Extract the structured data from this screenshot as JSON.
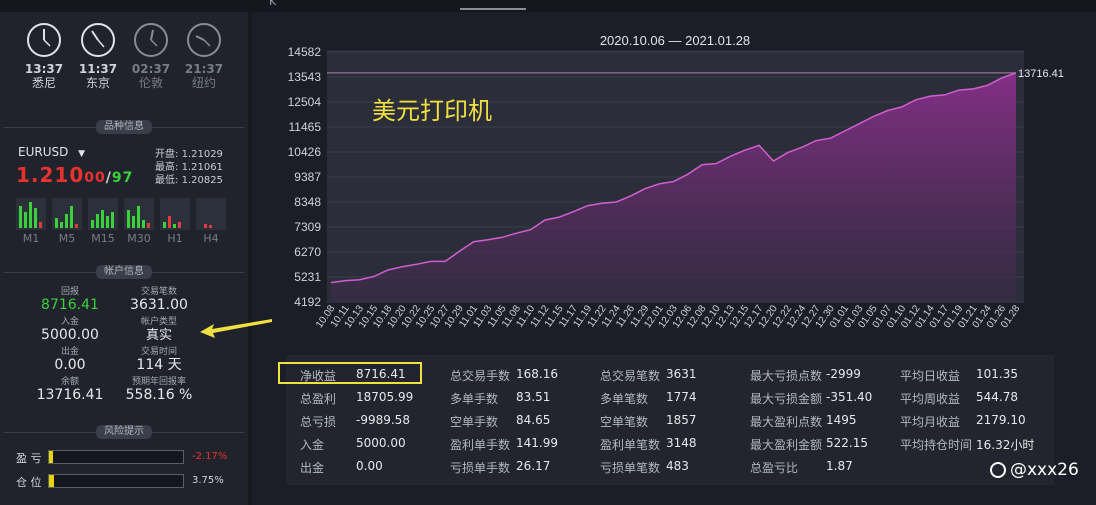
{
  "topbar": {
    "tab_fragment": "K"
  },
  "clocks": [
    {
      "time": "13:37",
      "city": "悉尼",
      "active": true
    },
    {
      "time": "11:37",
      "city": "东京",
      "active": true
    },
    {
      "time": "02:37",
      "city": "伦敦",
      "active": false
    },
    {
      "time": "21:37",
      "city": "纽约",
      "active": false
    }
  ],
  "instrument": {
    "section_title": "品种信息",
    "symbol": "EURUSD",
    "price_main": "1.210",
    "price_tail": "00",
    "price_sep": "/",
    "price_ask": "97",
    "open_label": "开盘:",
    "open": "1.21029",
    "high_label": "最高:",
    "high": "1.21061",
    "low_label": "最低:",
    "low": "1.20825",
    "timeframes": [
      "M1",
      "M5",
      "M15",
      "M30",
      "H1",
      "H4"
    ]
  },
  "account": {
    "section_title": "帐户信息",
    "return_label": "回报",
    "return_value": "8716.41",
    "trade_lots_label": "交易笔数",
    "trade_lots_value": "3631.00",
    "deposit_label": "入金",
    "deposit_value": "5000.00",
    "type_label": "帐户类型",
    "type_value": "真实",
    "withdraw_label": "出金",
    "withdraw_value": "0.00",
    "time_label": "交易时间",
    "time_value": "114 天",
    "balance_label": "余额",
    "balance_value": "13716.41",
    "annual_label": "预期年回报率",
    "annual_value": "558.16 %"
  },
  "risk": {
    "section_title": "风险提示",
    "pl_label": "盈 亏",
    "pl_value": "-2.17%",
    "pl_fill": 0.03,
    "pos_label": "仓 位",
    "pos_value": "3.75%",
    "pos_fill": 0.0375
  },
  "chart_data": {
    "type": "area",
    "title": "2020.10.06 — 2021.01.28",
    "annotation": "美元打印机",
    "last_value_label": "13716.41",
    "ylim": [
      4192,
      14582
    ],
    "y_ticks": [
      "14582",
      "13543",
      "12504",
      "11465",
      "10426",
      "9387",
      "8348",
      "7309",
      "6270",
      "5231",
      "4192"
    ],
    "x": [
      "10.08",
      "10.11",
      "10.13",
      "10.15",
      "10.18",
      "10.20",
      "10.22",
      "10.25",
      "10.27",
      "10.29",
      "11.01",
      "11.03",
      "11.05",
      "11.08",
      "11.10",
      "11.12",
      "11.15",
      "11.17",
      "11.19",
      "11.22",
      "11.24",
      "11.26",
      "11.29",
      "12.01",
      "12.03",
      "12.06",
      "12.08",
      "12.10",
      "12.13",
      "12.15",
      "12.17",
      "12.20",
      "12.22",
      "12.24",
      "12.27",
      "12.30",
      "01.01",
      "01.03",
      "01.05",
      "01.07",
      "01.10",
      "01.12",
      "01.14",
      "01.17",
      "01.19",
      "01.21",
      "01.24",
      "01.26",
      "01.28"
    ],
    "values": [
      5000,
      5080,
      5120,
      5250,
      5520,
      5660,
      5760,
      5880,
      5880,
      6300,
      6700,
      6780,
      6880,
      7050,
      7200,
      7600,
      7720,
      7950,
      8200,
      8300,
      8350,
      8600,
      8900,
      9100,
      9200,
      9500,
      9900,
      9950,
      10250,
      10500,
      10700,
      10050,
      10400,
      10620,
      10900,
      11000,
      11300,
      11600,
      11900,
      12150,
      12300,
      12600,
      12750,
      12800,
      13000,
      13050,
      13200,
      13500,
      13716.41
    ],
    "reference_line": 13716.41
  },
  "stats": {
    "columns": [
      [
        {
          "label": "净收益",
          "value": "8716.41"
        },
        {
          "label": "总盈利",
          "value": "18705.99"
        },
        {
          "label": "总亏损",
          "value": "-9989.58"
        },
        {
          "label": "入金",
          "value": "5000.00"
        },
        {
          "label": "出金",
          "value": "0.00"
        }
      ],
      [
        {
          "label": "总交易手数",
          "value": "168.16"
        },
        {
          "label": "多单手数",
          "value": "83.51"
        },
        {
          "label": "空单手数",
          "value": "84.65"
        },
        {
          "label": "盈利单手数",
          "value": "141.99"
        },
        {
          "label": "亏损单手数",
          "value": "26.17"
        }
      ],
      [
        {
          "label": "总交易笔数",
          "value": "3631"
        },
        {
          "label": "多单笔数",
          "value": "1774"
        },
        {
          "label": "空单笔数",
          "value": "1857"
        },
        {
          "label": "盈利单笔数",
          "value": "3148"
        },
        {
          "label": "亏损单笔数",
          "value": "483"
        }
      ],
      [
        {
          "label": "最大亏损点数",
          "value": "-2999"
        },
        {
          "label": "最大亏损金额",
          "value": "-351.40"
        },
        {
          "label": "最大盈利点数",
          "value": "1495"
        },
        {
          "label": "最大盈利金额",
          "value": "522.15"
        },
        {
          "label": "总盈亏比",
          "value": "1.87"
        }
      ],
      [
        {
          "label": "平均日收益",
          "value": "101.35"
        },
        {
          "label": "平均周收益",
          "value": "544.78"
        },
        {
          "label": "平均月收益",
          "value": "2179.10"
        },
        {
          "label": "平均持仓时间",
          "value": "16.32小时"
        }
      ]
    ]
  },
  "watermark": "@xxx26",
  "colors": {
    "accent_area": "#7a2a7a",
    "line": "#c050c0",
    "profit": "#3bd13b",
    "loss": "#e8322e",
    "highlight": "#f0e040"
  }
}
